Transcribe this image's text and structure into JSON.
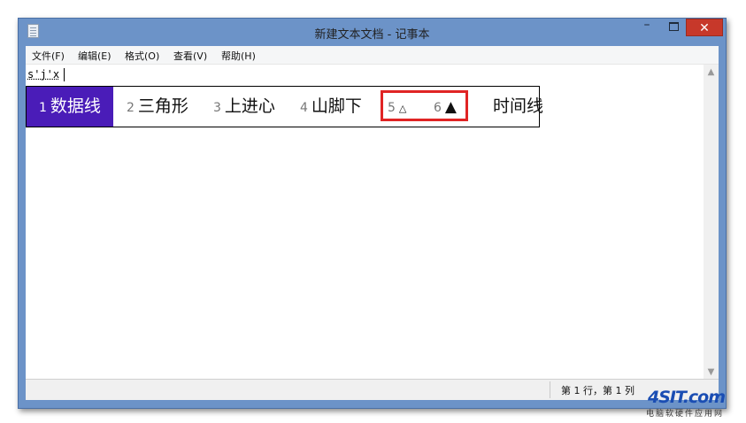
{
  "window": {
    "title": "新建文本文档 - 记事本",
    "minimize_glyph": "–",
    "close_glyph": "✕"
  },
  "menu": [
    "文件(F)",
    "编辑(E)",
    "格式(O)",
    "查看(V)",
    "帮助(H)"
  ],
  "editor": {
    "typed_text": "s'j'x"
  },
  "ime": {
    "candidates": [
      {
        "num": "1",
        "text": "数据线",
        "selected": true
      },
      {
        "num": "2",
        "text": "三角形"
      },
      {
        "num": "3",
        "text": "上进心"
      },
      {
        "num": "4",
        "text": "山脚下"
      },
      {
        "num": "5",
        "text": "△"
      },
      {
        "num": "6",
        "text": "▲"
      },
      {
        "num": "",
        "text": "时间线"
      }
    ]
  },
  "status": {
    "position": "第 1 行，第 1 列"
  },
  "watermark": {
    "logo": "4SIT.com",
    "subtitle": "电脑软硬件应用网"
  },
  "colors": {
    "titlebar": "#6c93c8",
    "ime_selected": "#4a1cb8",
    "close_button": "#c7382a",
    "highlight_box": "#e02424"
  }
}
